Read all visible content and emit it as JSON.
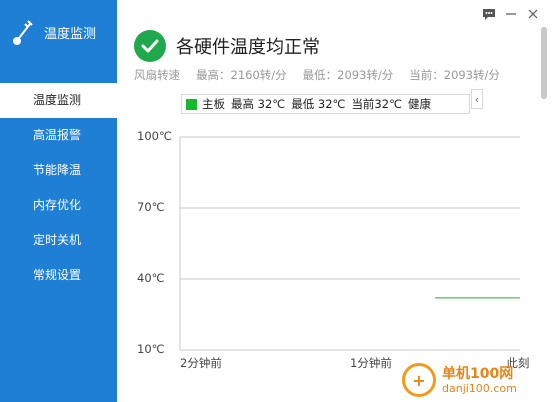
{
  "app": {
    "title": "温度监测"
  },
  "nav": [
    {
      "label": "温度监测",
      "active": true
    },
    {
      "label": "高温报警",
      "active": false
    },
    {
      "label": "节能降温",
      "active": false
    },
    {
      "label": "内存优化",
      "active": false
    },
    {
      "label": "定时关机",
      "active": false
    },
    {
      "label": "常规设置",
      "active": false
    }
  ],
  "window_controls": {
    "feedback_icon": "chat-icon",
    "minimize": "—",
    "close": "✕"
  },
  "status": {
    "title": "各硬件温度均正常",
    "icon": "check-circle-icon",
    "color": "#1fa94c"
  },
  "metrics": {
    "fan_label": "风扇转速",
    "max": "最高：2160转/分",
    "min": "最低：2093转/分",
    "current": "当前：2093转/分"
  },
  "legend": {
    "name": "主板",
    "max": "最高 32℃",
    "min": "最低 32℃",
    "current": "当前32℃",
    "state": "健康",
    "color": "#16b82c",
    "collapse": "‹"
  },
  "chart_data": {
    "type": "line",
    "yticks": [
      "100℃",
      "70℃",
      "40℃",
      "10℃"
    ],
    "ylim": [
      10,
      100
    ],
    "xticks": [
      "2分钟前",
      "1分钟前",
      "此刻"
    ],
    "series": [
      {
        "name": "主板",
        "points": [
          {
            "t": 0.75,
            "y": 32
          },
          {
            "t": 1.0,
            "y": 32
          }
        ]
      }
    ],
    "grid": true
  },
  "watermark": {
    "line1": "单机100网",
    "line2": "danji100.com",
    "mark": "+"
  }
}
